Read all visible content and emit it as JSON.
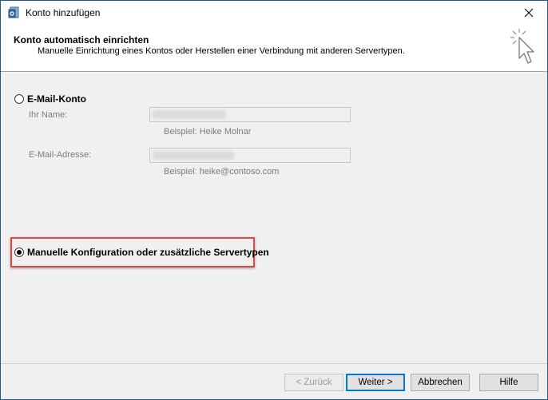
{
  "window": {
    "title": "Konto hinzufügen"
  },
  "header": {
    "title": "Konto automatisch einrichten",
    "subtitle": "Manuelle Einrichtung eines Kontos oder Herstellen einer Verbindung mit anderen Servertypen."
  },
  "email_option": {
    "label": "E-Mail-Konto",
    "selected": false,
    "name_label": "Ihr Name:",
    "name_example": "Beispiel: Heike Molnar",
    "email_label": "E-Mail-Adresse:",
    "email_example": "Beispiel: heike@contoso.com"
  },
  "manual_option": {
    "label": "Manuelle Konfiguration oder zusätzliche Servertypen",
    "selected": true
  },
  "buttons": {
    "back": "< Zurück",
    "next": "Weiter >",
    "cancel": "Abbrechen",
    "help": "Hilfe"
  },
  "colors": {
    "highlight": "#e04646",
    "default_button_border": "#0078d7",
    "window_border": "#1e5a86"
  }
}
